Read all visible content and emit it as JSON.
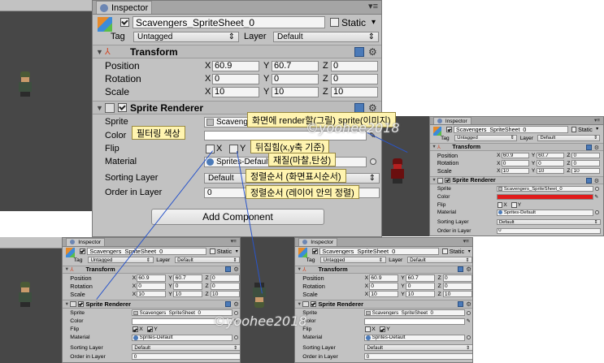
{
  "inspector": {
    "tab": "Inspector",
    "object_name": "Scavengers_SpriteSheet_0",
    "static_label": "Static",
    "tag_label": "Tag",
    "tag_value": "Untagged",
    "layer_label": "Layer",
    "layer_value": "Default",
    "transform": {
      "title": "Transform",
      "rows": [
        {
          "label": "Position",
          "x": "60.9",
          "y": "60.7",
          "z": "0"
        },
        {
          "label": "Rotation",
          "x": "0",
          "y": "0",
          "z": "0"
        },
        {
          "label": "Scale",
          "x": "10",
          "y": "10",
          "z": "10"
        }
      ]
    },
    "sprite_renderer": {
      "title": "Sprite Renderer",
      "sprite_label": "Sprite",
      "sprite_value_short": "Scaver",
      "sprite_value": "Scavengers_SpriteSheet_0",
      "color_label": "Color",
      "flip_label": "Flip",
      "flip_x": "X",
      "flip_y": "Y",
      "material_label": "Material",
      "material_value": "Sprites-Default",
      "sorting_layer_label": "Sorting Layer",
      "sorting_layer_value": "Default",
      "order_label": "Order in Layer",
      "order_value": "0"
    },
    "add_component": "Add Component",
    "axes": {
      "x": "X",
      "y": "Y",
      "z": "Z"
    }
  },
  "annotations": {
    "sprite": "화면에 render할(그릴) sprite(이미지)",
    "color": "필터링 색상",
    "flip": "뒤집힘(x,y축 기준)",
    "material": "재질(마찰,탄성)",
    "sorting": "정렬순서 (화면표시순서)",
    "order": "정렬순서 (레이어 안의 정렬)"
  },
  "watermark": "©yoohee2018",
  "colors": {
    "red_tint": "#e01b1b",
    "annotation_bg": "#fff4b0",
    "connector": "#2a55c9"
  }
}
